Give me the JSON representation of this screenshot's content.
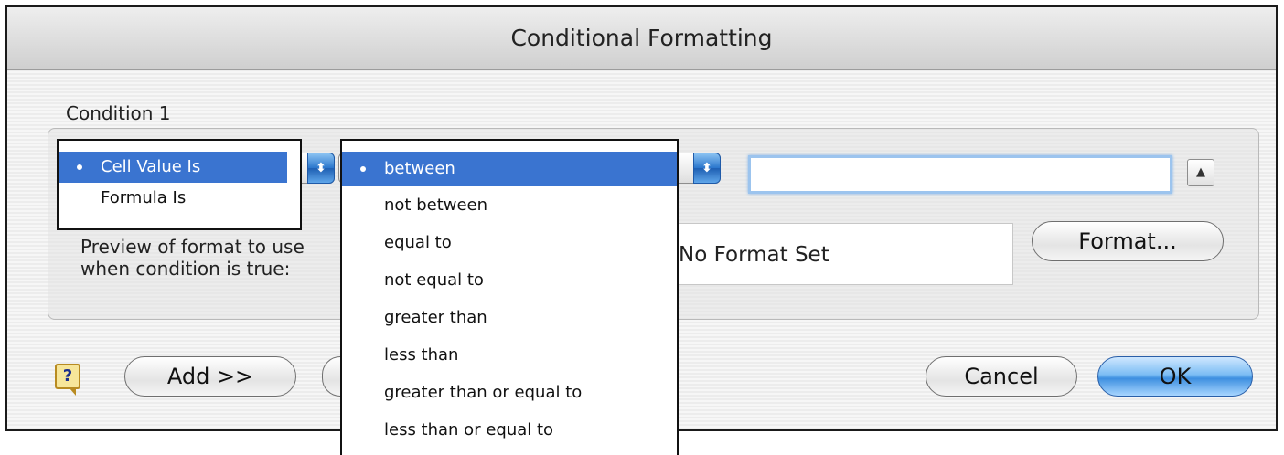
{
  "dialog": {
    "title": "Conditional Formatting",
    "condition_label": "Condition 1",
    "preview_label_line1": "Preview of format to use",
    "preview_label_line2": "when condition is true:",
    "preview_text": "No Format Set",
    "format_button": "Format...",
    "add_button": "Add >>",
    "cancel_button": "Cancel",
    "ok_button": "OK",
    "help_icon": "?",
    "collapse_icon": "▲"
  },
  "type_menu": {
    "selected_index": 0,
    "items": [
      "Cell Value Is",
      "Formula Is"
    ]
  },
  "operator_menu": {
    "selected_index": 0,
    "items": [
      "between",
      "not between",
      "equal to",
      "not equal to",
      "greater than",
      "less than",
      "greater than or equal to",
      "less than or equal to"
    ]
  },
  "value_field": {
    "value": ""
  },
  "colors": {
    "selection": "#3a74d0",
    "accent_blue": "#7cbdf4"
  }
}
